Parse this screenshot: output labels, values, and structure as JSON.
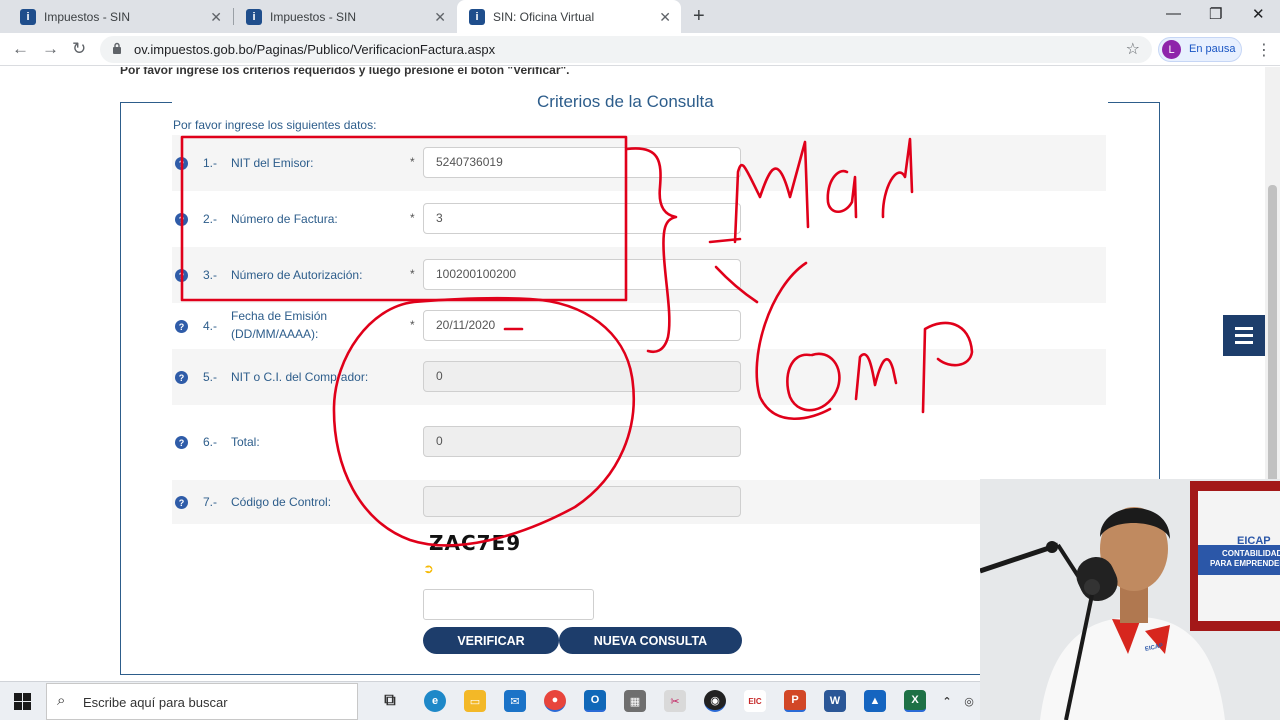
{
  "browser": {
    "tabs": [
      {
        "title": "Impuestos - SIN",
        "favicon": "sin-favicon",
        "active": false
      },
      {
        "title": "Impuestos - SIN",
        "favicon": "sin-favicon",
        "active": false
      },
      {
        "title": "SIN: Oficina Virtual",
        "favicon": "sin-favicon",
        "active": true
      }
    ],
    "url": "ov.impuestos.gob.bo/Paginas/Publico/VerificacionFactura.aspx",
    "profile_initial": "L",
    "profile_status": "En pausa"
  },
  "page": {
    "cut_text": "Por favor ingrese los criterios requeridos y luego presione el botón \"Verificar\".",
    "title": "Criterios de la Consulta",
    "intro": "Por favor ingrese los siguientes datos:",
    "fields": [
      {
        "num": "1.-",
        "label": "NIT del Emisor:",
        "required": "*",
        "value": "5240736019",
        "disabled": false
      },
      {
        "num": "2.-",
        "label": "Número de Factura:",
        "required": "*",
        "value": "3",
        "disabled": false
      },
      {
        "num": "3.-",
        "label": "Número de Autorización:",
        "required": "*",
        "value": "100200100200",
        "disabled": false
      },
      {
        "num": "4.-",
        "label": "Fecha de Emisión\n(DD/MM/AAAA):",
        "required": "*",
        "value": "20/11/2020",
        "disabled": false
      },
      {
        "num": "5.-",
        "label": "NIT o C.I. del Comprador:",
        "required": "",
        "value": "0",
        "disabled": true
      },
      {
        "num": "6.-",
        "label": "Total:",
        "required": "",
        "value": "0",
        "disabled": true
      },
      {
        "num": "7.-",
        "label": "Código de Control:",
        "required": "",
        "value": "",
        "disabled": true
      }
    ],
    "captcha": "ZAC7E9",
    "verify_label": "VERIFICAR",
    "new_query_label": "NUEVA CONSULTA"
  },
  "annotations": {
    "handwriting_1": "Man",
    "handwriting_2": "Comp",
    "ink_color": "#e0001a"
  },
  "taskbar": {
    "search_placeholder": "Escribe aquí para buscar",
    "apps": [
      "task-view",
      "edge",
      "file-explorer",
      "mail",
      "chrome",
      "outlook",
      "calculator",
      "snipping",
      "obs",
      "eicap",
      "powerpoint",
      "word",
      "photos",
      "excel"
    ]
  },
  "webcam": {
    "banner_title": "EICAP",
    "banner_line1": "CONTABILIDAD",
    "banner_line2": "PARA EMPRENDEDO",
    "shirt_logo": "EICAP"
  }
}
